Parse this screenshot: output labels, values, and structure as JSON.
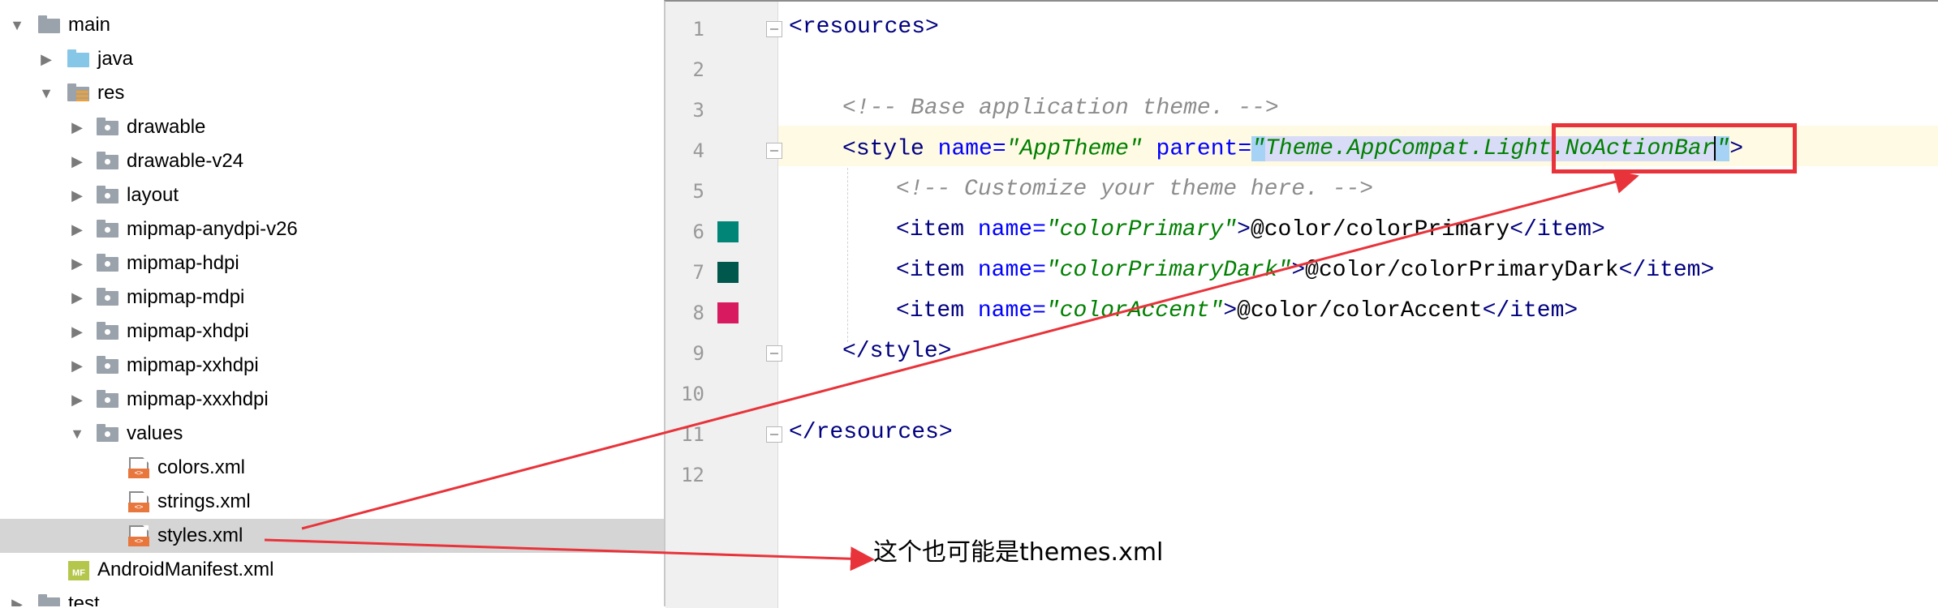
{
  "project_tree": {
    "items": [
      {
        "label": "main",
        "icon": "folder-icon",
        "expanded": true
      },
      {
        "label": "java",
        "icon": "source-folder-icon",
        "expanded": false
      },
      {
        "label": "res",
        "icon": "resource-folder-icon",
        "expanded": true
      },
      {
        "label": "drawable",
        "icon": "folder-icon",
        "expanded": false
      },
      {
        "label": "drawable-v24",
        "icon": "folder-icon",
        "expanded": false
      },
      {
        "label": "layout",
        "icon": "folder-icon",
        "expanded": false
      },
      {
        "label": "mipmap-anydpi-v26",
        "icon": "folder-icon",
        "expanded": false
      },
      {
        "label": "mipmap-hdpi",
        "icon": "folder-icon",
        "expanded": false
      },
      {
        "label": "mipmap-mdpi",
        "icon": "folder-icon",
        "expanded": false
      },
      {
        "label": "mipmap-xhdpi",
        "icon": "folder-icon",
        "expanded": false
      },
      {
        "label": "mipmap-xxhdpi",
        "icon": "folder-icon",
        "expanded": false
      },
      {
        "label": "mipmap-xxxhdpi",
        "icon": "folder-icon",
        "expanded": false
      },
      {
        "label": "values",
        "icon": "folder-icon",
        "expanded": true
      },
      {
        "label": "colors.xml",
        "icon": "xml-file-icon"
      },
      {
        "label": "strings.xml",
        "icon": "xml-file-icon"
      },
      {
        "label": "styles.xml",
        "icon": "xml-file-icon",
        "selected": true
      },
      {
        "label": "AndroidManifest.xml",
        "icon": "manifest-file-icon"
      },
      {
        "label": "test",
        "icon": "folder-icon",
        "expanded": false
      }
    ]
  },
  "editor": {
    "line_numbers": [
      "1",
      "2",
      "3",
      "4",
      "5",
      "6",
      "7",
      "8",
      "9",
      "10",
      "11",
      "12"
    ],
    "lines": {
      "l1": {
        "open": "<",
        "name": "resources",
        "close": ">"
      },
      "l3": {
        "comment": "<!-- Base application theme. -->"
      },
      "l4": {
        "open": "<",
        "tag": "style",
        "attr1": "name",
        "eq1": "=",
        "val1": "\"AppTheme\"",
        "attr2": "parent",
        "eq2": "=",
        "q_open": "\"",
        "parent_a": "Theme.AppCompat.Light.",
        "parent_b": "NoActionBar",
        "q_close": "\"",
        "close": ">"
      },
      "l5": {
        "comment": "<!-- Customize your theme here. -->"
      },
      "l6": {
        "open": "<",
        "tag": "item",
        "attr": "name",
        "eq": "=",
        "val": "\"colorPrimary\"",
        "gt": ">",
        "text": "@color/colorPrimary",
        "end_open": "</",
        "end_tag": "item",
        "end_close": ">"
      },
      "l7": {
        "open": "<",
        "tag": "item",
        "attr": "name",
        "eq": "=",
        "val": "\"colorPrimaryDark\"",
        "gt": ">",
        "text": "@color/colorPrimaryDark",
        "end_open": "</",
        "end_tag": "item",
        "end_close": ">"
      },
      "l8": {
        "open": "<",
        "tag": "item",
        "attr": "name",
        "eq": "=",
        "val": "\"colorAccent\"",
        "gt": ">",
        "text": "@color/colorAccent",
        "end_open": "</",
        "end_tag": "item",
        "end_close": ">"
      },
      "l9": {
        "open": "</",
        "tag": "style",
        "close": ">"
      },
      "l11": {
        "open": "</",
        "tag": "resources",
        "close": ">"
      }
    },
    "color_swatches": {
      "colorPrimary": "#008577",
      "colorPrimaryDark": "#00574B",
      "colorAccent": "#D81B60"
    }
  },
  "annotation": {
    "note": "这个也可能是themes.xml",
    "color": "#e8333a"
  }
}
